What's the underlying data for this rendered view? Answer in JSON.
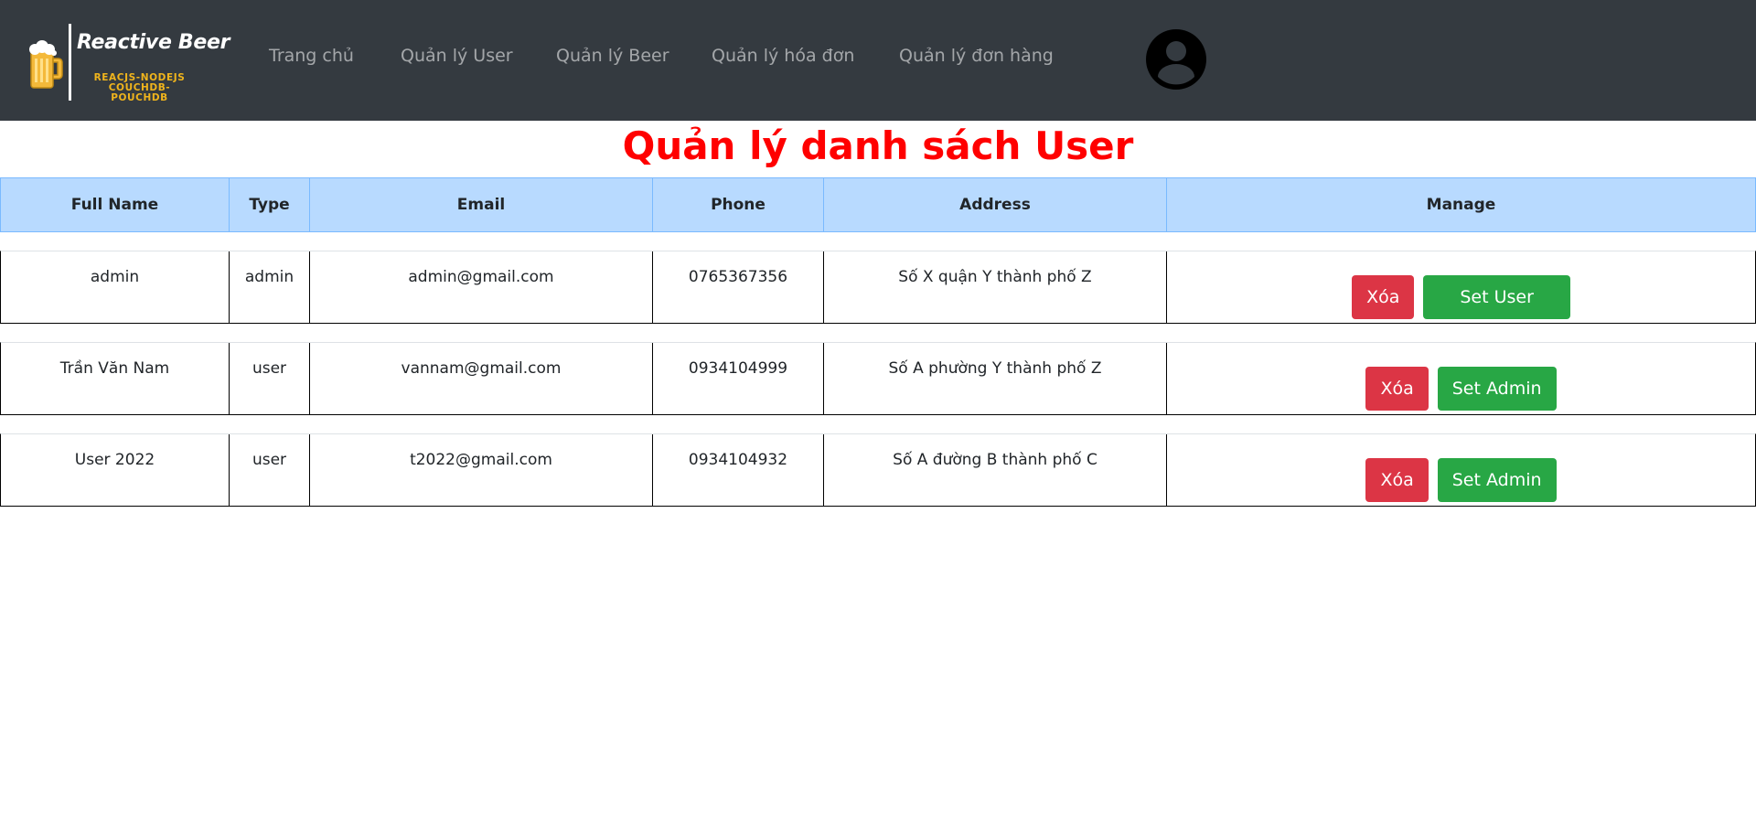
{
  "brand": {
    "title": "Reactive Beer",
    "subtitle_line1": "REACJS-NODEJS",
    "subtitle_line2": "COUCHDB-POUCHDB",
    "colors": {
      "title": "#ffffff",
      "subtitle": "#f0b41c"
    }
  },
  "nav": {
    "items": [
      {
        "label": "Trang chủ"
      },
      {
        "label": "Quản lý User"
      },
      {
        "label": "Quản lý Beer"
      },
      {
        "label": "Quản lý hóa đơn"
      },
      {
        "label": "Quản lý đơn hàng"
      }
    ],
    "avatar_icon": "user-circle-icon"
  },
  "page": {
    "title": "Quản lý danh sách User",
    "title_color": "#ff0000"
  },
  "table": {
    "headers": [
      "Full Name",
      "Type",
      "Email",
      "Phone",
      "Address",
      "Manage"
    ],
    "header_bg": "#b8daff",
    "rows": [
      {
        "full_name": "admin",
        "type": "admin",
        "email": "admin@gmail.com",
        "phone": "0765367356",
        "address": "Số X quận Y thành phố Z",
        "delete_label": "Xóa",
        "role_label": "Set User"
      },
      {
        "full_name": "Trần Văn Nam",
        "type": "user",
        "email": "vannam@gmail.com",
        "phone": "0934104999",
        "address": "Số A phường Y thành phố Z",
        "delete_label": "Xóa",
        "role_label": "Set Admin"
      },
      {
        "full_name": "User 2022",
        "type": "user",
        "email": "t2022@gmail.com",
        "phone": "0934104932",
        "address": "Số A đường B thành phố C",
        "delete_label": "Xóa",
        "role_label": "Set Admin"
      }
    ],
    "button_colors": {
      "delete": "#dc3545",
      "role": "#28a745"
    }
  }
}
